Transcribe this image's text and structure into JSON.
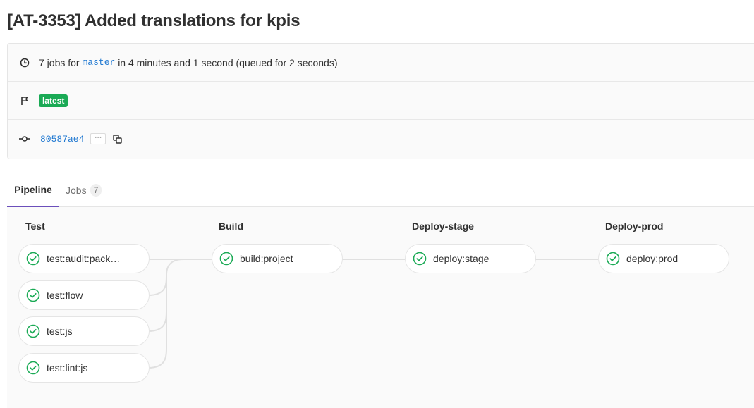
{
  "page": {
    "title": "[AT-3353] Added translations for kpis"
  },
  "info": {
    "jobs_prefix": "7 jobs for",
    "branch": "master",
    "jobs_suffix": "in 4 minutes and 1 second (queued for 2 seconds)",
    "tag_badge": "latest",
    "commit_sha": "80587ae4",
    "ellipsis": "···"
  },
  "tabs": {
    "pipeline": "Pipeline",
    "jobs": "Jobs",
    "jobs_count": "7"
  },
  "stages": [
    {
      "name": "Test",
      "jobs": [
        "test:audit:pack…",
        "test:flow",
        "test:js",
        "test:lint:js"
      ]
    },
    {
      "name": "Build",
      "jobs": [
        "build:project"
      ]
    },
    {
      "name": "Deploy-stage",
      "jobs": [
        "deploy:stage"
      ]
    },
    {
      "name": "Deploy-prod",
      "jobs": [
        "deploy:prod"
      ]
    }
  ],
  "colors": {
    "success": "#1aaa55",
    "link": "#1f78d1",
    "active_tab": "#6b4fbb"
  },
  "icons": {
    "duration": "clock-icon",
    "tag": "flag-icon",
    "commit": "commit-icon",
    "copy": "copy-icon",
    "job_status": "status-success-icon"
  }
}
